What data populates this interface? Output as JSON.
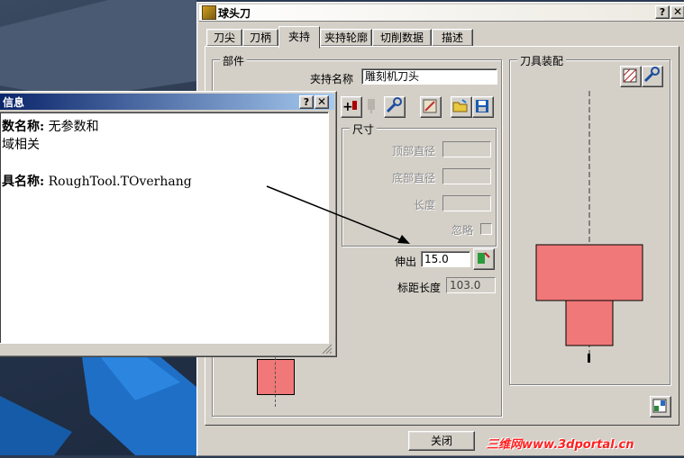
{
  "main_window": {
    "title": "球头刀",
    "tabs": [
      "刀尖",
      "刀柄",
      "夹持",
      "夹持轮廓",
      "切削数据",
      "描述"
    ],
    "active_tab": "夹持"
  },
  "parts_group": {
    "label": "部件",
    "holder_name_label": "夹持名称",
    "holder_name_value": "雕刻机刀头",
    "dimensions": {
      "label": "尺寸",
      "top_diameter": "顶部直径",
      "bottom_diameter": "底部直径",
      "length": "长度",
      "ignore": "忽略"
    },
    "extend_label": "伸出",
    "extend_value": "15.0",
    "gauge_label": "标距长度",
    "gauge_value": "103.0"
  },
  "assembly_group": {
    "label": "刀具装配"
  },
  "close_button": "关闭",
  "info_window": {
    "title": "信息",
    "line1_label": "数名称:",
    "line1_value": "无参数和",
    "line2": "域相关",
    "line3_label": "具名称:",
    "line3_value": "RoughTool.TOverhang"
  },
  "watermark": "三维网www.3dportal.cn",
  "colors": {
    "tool_fill": "#f07878",
    "titlebar": "#0a246a",
    "face": "#d4d0c8"
  }
}
